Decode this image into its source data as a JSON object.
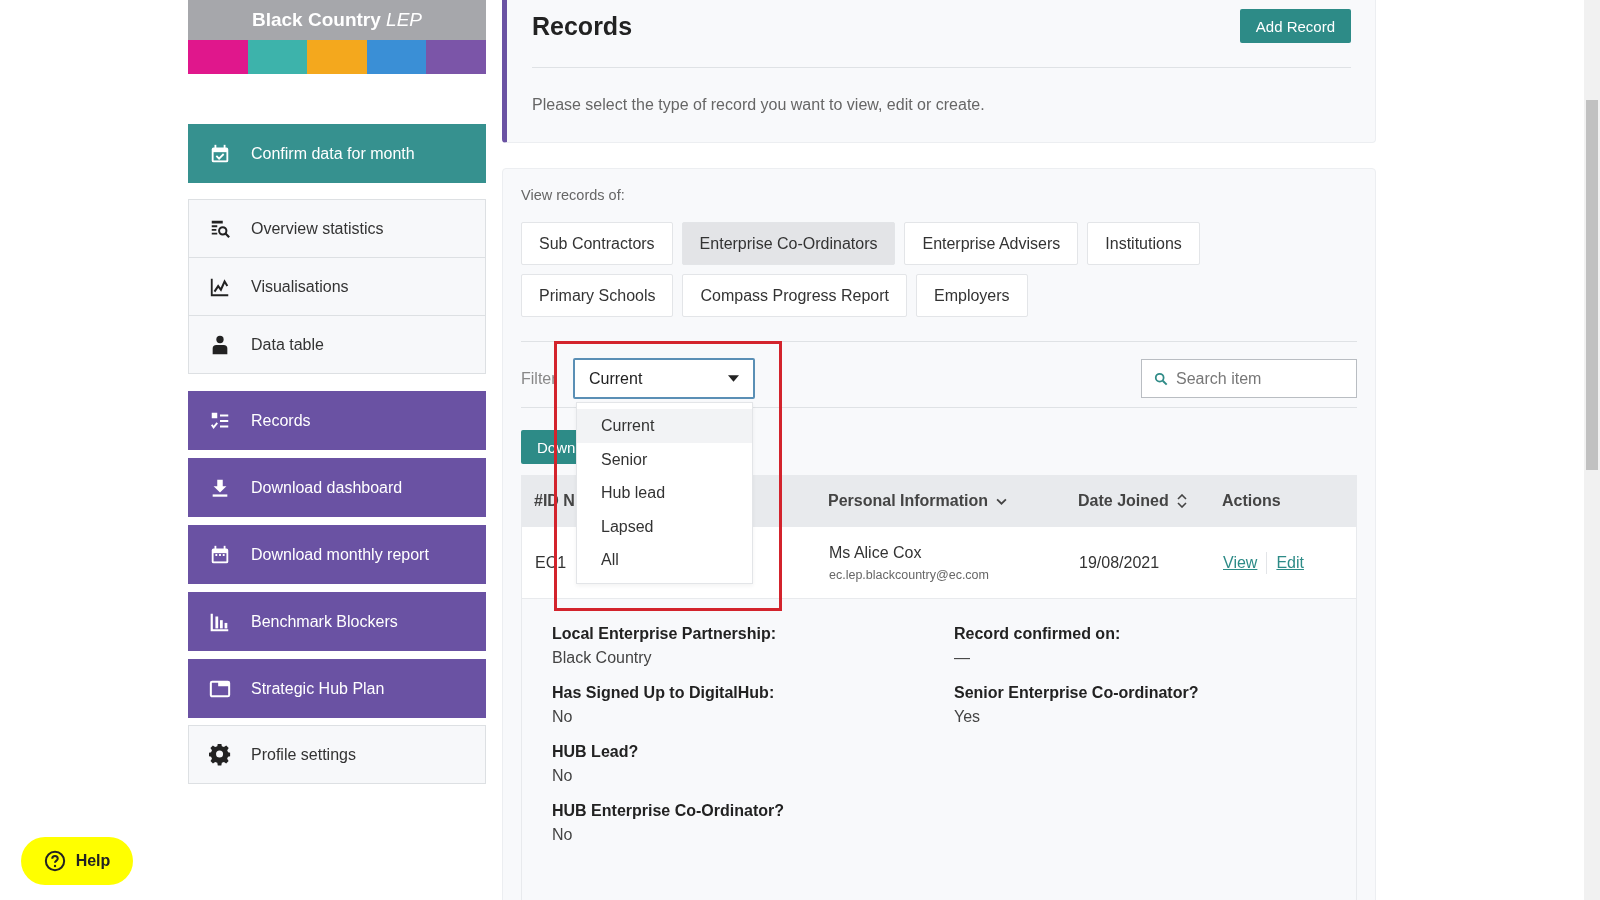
{
  "logo": {
    "title": "Black Country",
    "suffix": "LEP",
    "stripes": [
      {
        "color": "#e0178c"
      },
      {
        "color": "#3db3ab"
      },
      {
        "color": "#f4a81d"
      },
      {
        "color": "#3a8fd6"
      },
      {
        "color": "#7b55a8"
      }
    ]
  },
  "sidebar": {
    "items": [
      {
        "label": "Confirm data for month",
        "kind": "confirm"
      },
      {
        "label": "Overview statistics",
        "kind": "plain"
      },
      {
        "label": "Visualisations",
        "kind": "plain"
      },
      {
        "label": "Data table",
        "kind": "plain"
      },
      {
        "label": "Records",
        "kind": "purple"
      },
      {
        "label": "Download dashboard",
        "kind": "purple"
      },
      {
        "label": "Download monthly report",
        "kind": "purple"
      },
      {
        "label": "Benchmark Blockers",
        "kind": "purple"
      },
      {
        "label": "Strategic Hub Plan",
        "kind": "purple"
      },
      {
        "label": "Profile settings",
        "kind": "plain"
      }
    ]
  },
  "help_button": "Help",
  "header": {
    "title": "Records",
    "add_button": "Add Record",
    "description": "Please select the type of record you want to view, edit or create."
  },
  "records_panel": {
    "label": "View records of:",
    "types": [
      {
        "label": "Sub Contractors",
        "selected": false
      },
      {
        "label": "Enterprise Co-Ordinators",
        "selected": true
      },
      {
        "label": "Enterprise Advisers",
        "selected": false
      },
      {
        "label": "Institutions",
        "selected": false
      },
      {
        "label": "Primary Schools",
        "selected": false
      },
      {
        "label": "Compass Progress Report",
        "selected": false
      },
      {
        "label": "Employers",
        "selected": false
      }
    ],
    "filter": {
      "label": "Filter",
      "value": "Current",
      "expanded": true,
      "highlighted": true,
      "options": [
        {
          "label": "Current",
          "selected": true
        },
        {
          "label": "Senior",
          "selected": false
        },
        {
          "label": "Hub lead",
          "selected": false
        },
        {
          "label": "Lapsed",
          "selected": false
        },
        {
          "label": "All",
          "selected": false
        }
      ]
    },
    "search": {
      "placeholder": "Search item"
    },
    "download_button": "Down",
    "table": {
      "columns": [
        {
          "label": "#ID N",
          "kind": "plain"
        },
        {
          "label": "Personal Information",
          "kind": "dropdown"
        },
        {
          "label": "Date Joined",
          "kind": "sortable"
        },
        {
          "label": "Actions",
          "kind": "plain"
        }
      ],
      "rows": [
        {
          "id": "EC1",
          "name": "Ms Alice Cox",
          "email": "ec.lep.blackcountry@ec.com",
          "date_joined": "19/08/2021",
          "actions": [
            "View",
            "Edit"
          ],
          "expanded": true,
          "details_left": [
            {
              "label": "Local Enterprise Partnership:",
              "value": "Black Country"
            },
            {
              "label": "Has Signed Up to DigitalHub:",
              "value": "No"
            },
            {
              "label": "HUB Lead?",
              "value": "No"
            },
            {
              "label": "HUB Enterprise Co-Ordinator?",
              "value": "No"
            }
          ],
          "details_right": [
            {
              "label": "Record confirmed on:",
              "value": "—"
            },
            {
              "label": "Senior Enterprise Co-ordinator?",
              "value": "Yes"
            }
          ]
        }
      ]
    }
  }
}
